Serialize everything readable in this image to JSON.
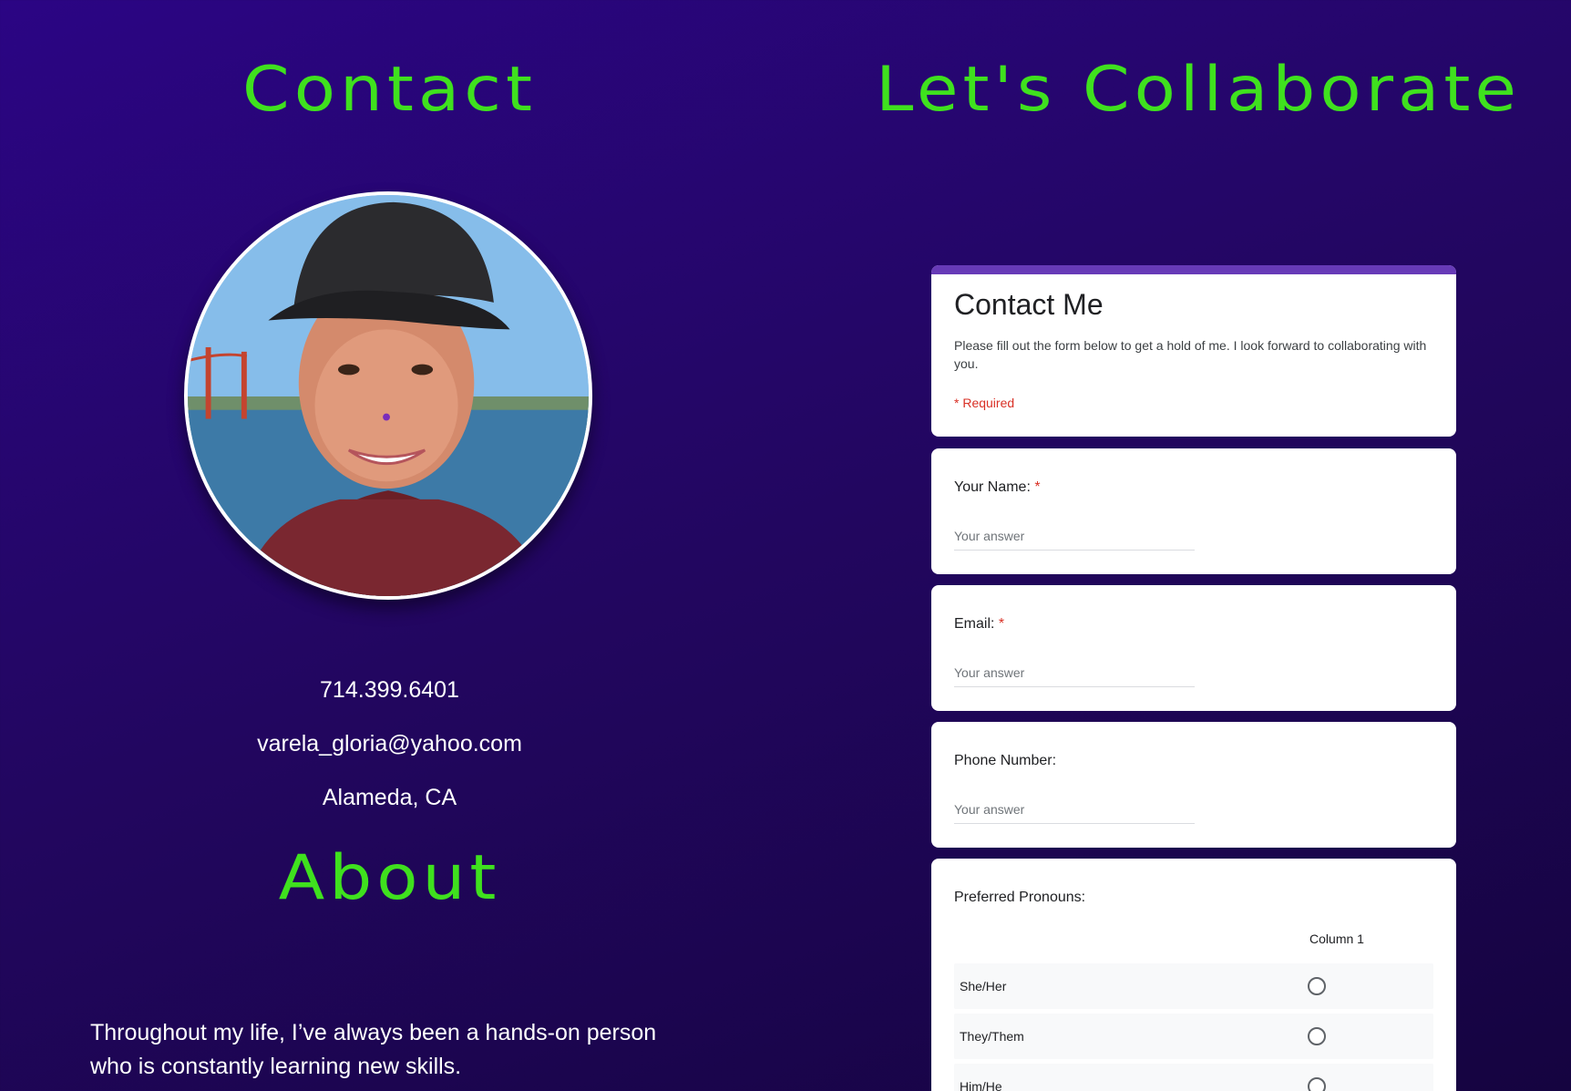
{
  "contact": {
    "heading": "Contact",
    "phone": "714.399.6401",
    "email": "varela_gloria@yahoo.com",
    "location": "Alameda, CA"
  },
  "about": {
    "heading": "About",
    "text": "Throughout my life, I’ve always been a hands-on person who is constantly learning new skills."
  },
  "collaborate": {
    "heading": "Let's Collaborate"
  },
  "form": {
    "title": "Contact Me",
    "description": "Please fill out the form below to get a hold of me. I look forward to collaborating with you.",
    "required_note": "* Required",
    "accent_color": "#673ab7",
    "required_color": "#d93025",
    "questions": [
      {
        "label": "Your Name:",
        "required_mark": "*",
        "placeholder": "Your answer"
      },
      {
        "label": "Email:",
        "required_mark": "*",
        "placeholder": "Your answer"
      },
      {
        "label": "Phone Number:",
        "required_mark": "",
        "placeholder": "Your answer"
      }
    ],
    "pronouns": {
      "label": "Preferred Pronouns:",
      "column_header": "Column 1",
      "rows": [
        "She/Her",
        "They/Them",
        "Him/He"
      ]
    }
  },
  "colors": {
    "heading_green": "#3fe11e",
    "background_purple": "#2b0584"
  }
}
